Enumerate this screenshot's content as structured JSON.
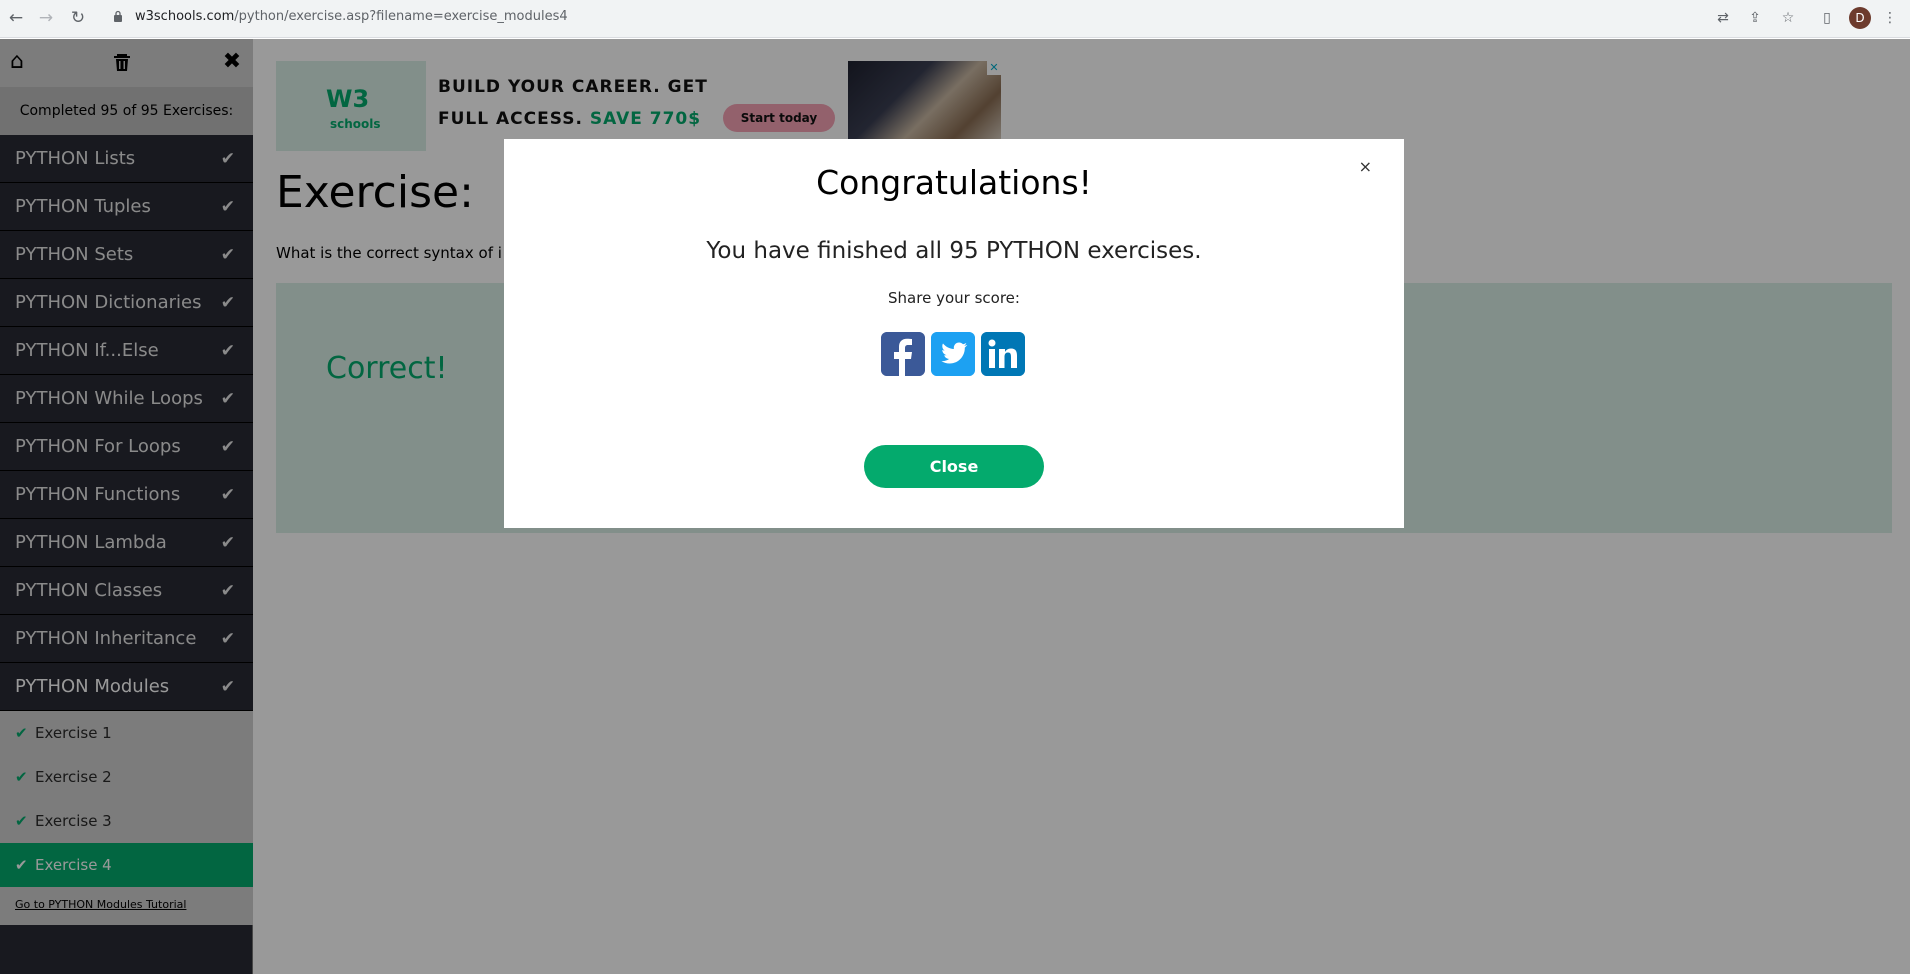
{
  "browser": {
    "url_host": "w3schools.com",
    "url_path": "/python/exercise.asp?filename=exercise_modules4",
    "profile_initial": "D"
  },
  "sidebar": {
    "progress": "Completed 95 of 95 Exercises:",
    "items": [
      {
        "label": "PYTHON Lists"
      },
      {
        "label": "PYTHON Tuples"
      },
      {
        "label": "PYTHON Sets"
      },
      {
        "label": "PYTHON Dictionaries"
      },
      {
        "label": "PYTHON If...Else"
      },
      {
        "label": "PYTHON While Loops"
      },
      {
        "label": "PYTHON For Loops"
      },
      {
        "label": "PYTHON Functions"
      },
      {
        "label": "PYTHON Lambda"
      },
      {
        "label": "PYTHON Classes"
      },
      {
        "label": "PYTHON Inheritance"
      },
      {
        "label": "PYTHON Modules"
      }
    ],
    "sub_items": [
      {
        "label": "Exercise 1"
      },
      {
        "label": "Exercise 2"
      },
      {
        "label": "Exercise 3"
      },
      {
        "label": "Exercise 4"
      }
    ],
    "tutorial_link": "Go to PYTHON Modules Tutorial"
  },
  "ad": {
    "logo_text": "W3",
    "logo_sub": "schools",
    "line1": "BUILD YOUR CAREER. GET",
    "line2_prefix": "FULL ACCESS.",
    "line2_highlight": "SAVE 770$",
    "cta": "Start today",
    "close_glyph": "✕"
  },
  "main": {
    "title": "Exercise:",
    "question": "What is the correct syntax of i",
    "result": "Correct!"
  },
  "modal": {
    "close_glyph": "×",
    "title": "Congratulations!",
    "message": "You have finished all 95 PYTHON exercises.",
    "share_label": "Share your score:",
    "close_button": "Close"
  },
  "colors": {
    "brand_green": "#04aa6d",
    "sidebar_dark": "#282a35",
    "facebook": "#3b5998",
    "twitter": "#1da1f2",
    "linkedin": "#0077b5"
  }
}
